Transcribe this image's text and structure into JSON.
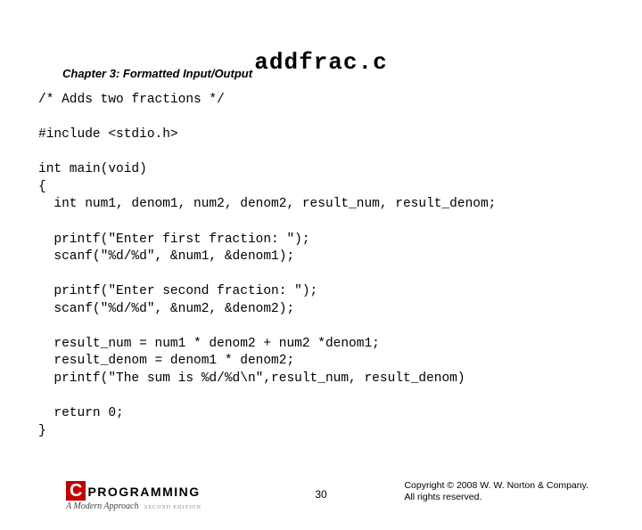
{
  "chapter": "Chapter 3: Formatted Input/Output",
  "title": "addfrac.c",
  "code": "/* Adds two fractions */\n\n#include <stdio.h>\n\nint main(void)\n{\n  int num1, denom1, num2, denom2, result_num, result_denom;\n\n  printf(\"Enter first fraction: \");\n  scanf(\"%d/%d\", &num1, &denom1);\n\n  printf(\"Enter second fraction: \");\n  scanf(\"%d/%d\", &num2, &denom2);\n\n  result_num = num1 * denom2 + num2 *denom1;\n  result_denom = denom1 * denom2;\n  printf(\"The sum is %d/%d\\n\",result_num, result_denom)\n\n  return 0;\n}",
  "logo": {
    "c": "C",
    "text": "PROGRAMMING",
    "subtitle": "A Modern Approach",
    "edition": "SECOND EDITION"
  },
  "page": "30",
  "copyright_line1": "Copyright © 2008 W. W. Norton & Company.",
  "copyright_line2": "All rights reserved."
}
